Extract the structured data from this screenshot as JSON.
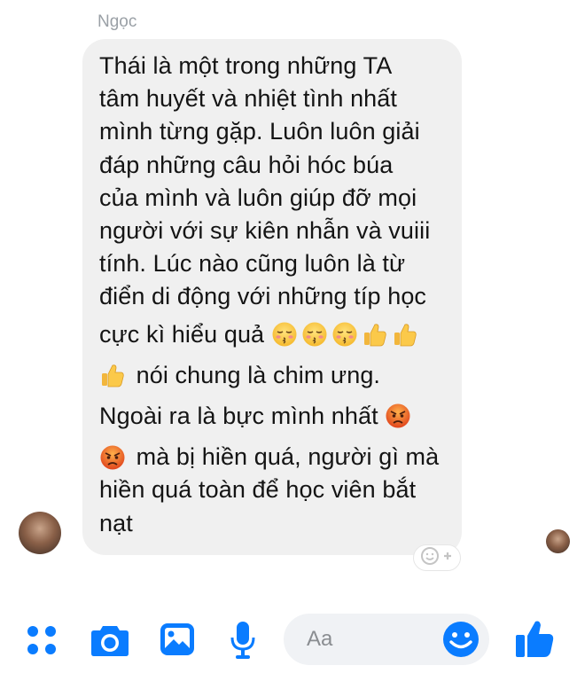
{
  "conversation": {
    "sender_name": "Ngọc",
    "message_lines": [
      {
        "parts": [
          {
            "text": "Thái là một trong những TA"
          }
        ]
      },
      {
        "parts": [
          {
            "text": "tâm huyết và nhiệt tình nhất"
          }
        ]
      },
      {
        "parts": [
          {
            "text": "mình từng gặp. Luôn luôn giải"
          }
        ]
      },
      {
        "parts": [
          {
            "text": "đáp những câu hỏi hóc búa"
          }
        ]
      },
      {
        "parts": [
          {
            "text": "của mình và luôn giúp đỡ mọi"
          }
        ]
      },
      {
        "parts": [
          {
            "text": "người với sự kiên nhẫn và vuiii"
          }
        ]
      },
      {
        "parts": [
          {
            "text": "tính. Lúc nào cũng luôn là từ"
          }
        ]
      },
      {
        "parts": [
          {
            "text": "điển di động với những típ học"
          }
        ]
      },
      {
        "parts": [
          {
            "text": "cực kì hiểu quả "
          },
          {
            "emoji": "kissing-face-emoji"
          },
          {
            "emoji": "kissing-face-emoji"
          },
          {
            "emoji": "kissing-face-emoji"
          },
          {
            "emoji": "thumbs-up-emoji"
          },
          {
            "emoji": "thumbs-up-emoji"
          }
        ]
      },
      {
        "parts": [
          {
            "emoji": "thumbs-up-emoji"
          },
          {
            "text": " nói chung là chim ưng."
          }
        ]
      },
      {
        "parts": [
          {
            "text": "Ngoài ra là bực mình nhất "
          },
          {
            "emoji": "angry-face-emoji"
          }
        ]
      },
      {
        "parts": [
          {
            "emoji": "angry-face-emoji"
          },
          {
            "text": " mà bị hiền quá, người gì mà"
          }
        ]
      },
      {
        "parts": [
          {
            "text": "hiền quá toàn để học viên bắt"
          }
        ]
      },
      {
        "parts": [
          {
            "text": "nạt"
          }
        ]
      }
    ],
    "reaction_button_icon": "add-reaction-icon"
  },
  "composer": {
    "placeholder": "Aa",
    "icons": [
      "more-actions-icon",
      "camera-icon",
      "gallery-icon",
      "microphone-icon",
      "emoji-icon",
      "thumbs-up-icon"
    ]
  },
  "colors": {
    "accent": "#0a7cff",
    "bubble_bg": "#f0f0f0",
    "text": "#141414",
    "sender_name": "#9aa0a6",
    "placeholder": "#8a8d91"
  }
}
